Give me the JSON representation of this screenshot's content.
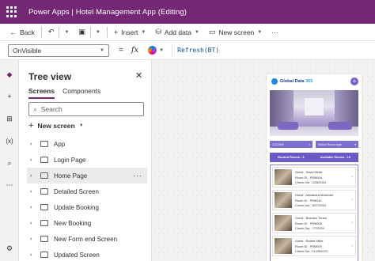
{
  "window": {
    "title": "Power Apps  |  Hotel Management App (Editing)"
  },
  "commandbar": {
    "back": "Back",
    "insert": "Insert",
    "add_data": "Add data",
    "new_screen": "New screen",
    "more": "···"
  },
  "formulabar": {
    "property": "OnVisible",
    "equals": "=",
    "fx": "fx",
    "formula": "Refresh(BT)"
  },
  "treeview": {
    "title": "Tree view",
    "tabs": [
      "Screens",
      "Components"
    ],
    "search_placeholder": "Search",
    "new_screen": "New screen",
    "items": [
      {
        "label": "App",
        "type": "app"
      },
      {
        "label": "Login Page",
        "type": "screen"
      },
      {
        "label": "Home Page",
        "type": "screen",
        "selected": true
      },
      {
        "label": "Detailed Screen",
        "type": "screen"
      },
      {
        "label": "Update Booking",
        "type": "screen"
      },
      {
        "label": "New Booking",
        "type": "screen"
      },
      {
        "label": "New Form end Screen",
        "type": "screen"
      },
      {
        "label": "Updated Screen",
        "type": "screen"
      }
    ]
  },
  "preview": {
    "brand_a": "Global Data",
    "brand_b": "365",
    "filter_date": "1/1/2001",
    "filter_type": "Select Room type",
    "booked": "Booked Rooms : 3",
    "available": "Available Rooms : 15",
    "cards": [
      {
        "guest": "Guest : David White",
        "room": "Room ID : PRM004",
        "checkout": "Check Out : 2/26/2024"
      },
      {
        "guest": "Guest : Alexandra Mckenzie",
        "room": "Room ID : PRM110",
        "checkout": "Check Out : 6/27/2024"
      },
      {
        "guest": "Guest : Brandon Torres",
        "room": "Room ID : PRM006",
        "checkout": "Check Out : 7/7/2024"
      },
      {
        "guest": "Guest : Robert Miller",
        "room": "Room ID : PRM009",
        "checkout": "Check Out : 11/25/2023"
      }
    ]
  },
  "colors": {
    "titlebar": "#742774",
    "accent": "#7b6fd0"
  }
}
